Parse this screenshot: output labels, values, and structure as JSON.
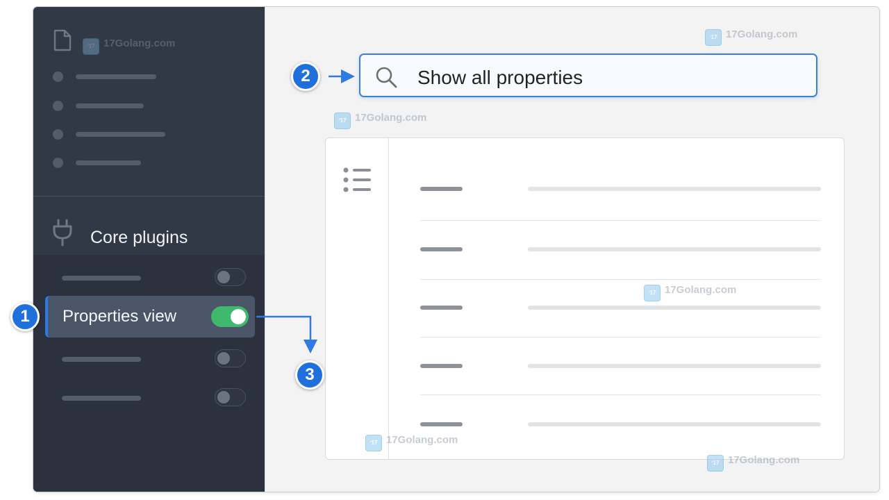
{
  "sidebar": {
    "section_title": "Core plugins",
    "active_plugin": {
      "label": "Properties view",
      "enabled": true
    },
    "other_plugins": [
      {
        "enabled": false
      },
      {
        "enabled": false
      },
      {
        "enabled": false
      }
    ]
  },
  "search": {
    "text": "Show all properties"
  },
  "steps": {
    "one": "1",
    "two": "2",
    "three": "3"
  },
  "watermark": {
    "text": "17Golang.com"
  },
  "colors": {
    "accent": "#1f6fdc",
    "toggle_on": "#3fb96c",
    "sidebar_bg": "#313945",
    "main_bg": "#f3f3f3"
  },
  "icons": {
    "file": "file-icon",
    "plugin": "plug-icon",
    "search": "search-icon",
    "properties": "list-icon"
  }
}
